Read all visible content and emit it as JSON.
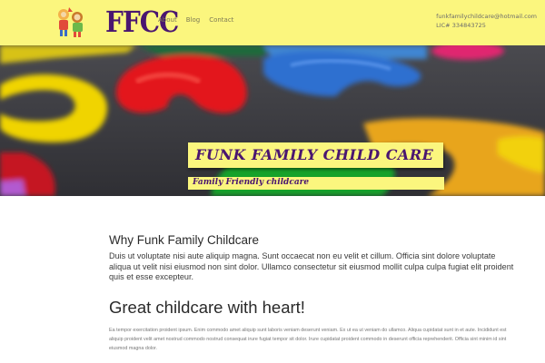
{
  "header": {
    "logo_text": "FFCC",
    "nav": [
      "About",
      "Blog",
      "Contact"
    ],
    "contact_email": "funkfamilychildcare@hotmail.com",
    "license": "LIC# 334843725"
  },
  "hero": {
    "title": "FUNK FAMILY CHILD CARE",
    "subtitle": "Family Friendly childcare"
  },
  "main": {
    "why_heading": "Why Funk Family Childcare",
    "why_text": "Duis ut voluptate nisi aute aliquip magna. Sunt occaecat non eu velit et cillum. Officia sint dolore voluptate aliqua ut velit nisi eiusmod non sint dolor. Ullamco consectetur sit eiusmod mollit culpa culpa fugiat elit proident quis et esse excepteur.",
    "great_heading": "Great childcare with heart!",
    "great_text": "Ea tempor exercitation proident ipsum. Enim commodo amet aliquip sunt laboris veniam deserunt veniam. Ex ut ea ut veniam do ullamco. Aliqua cupidatat sunt in et aute. Incididunt est aliquip proident velit amet nostrud commodo nostrud consequat irure fugiat tempor sit dolor. Irure cupidatat proident commodo in deserunt officia reprehenderit. Officia sint minim id sint eiusmod magna dolor."
  },
  "colors": {
    "header_bg": "#fbf67e",
    "brand_purple": "#4a1670"
  }
}
